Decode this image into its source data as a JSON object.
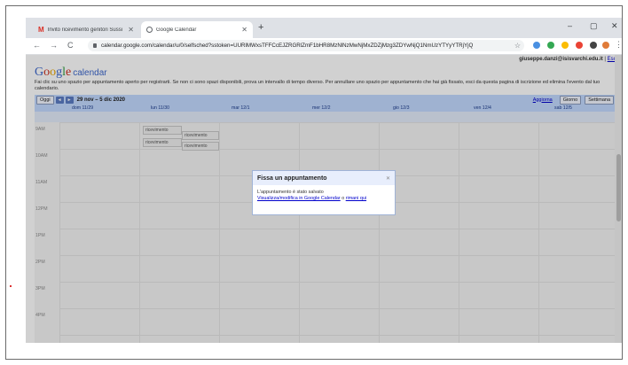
{
  "browser": {
    "tabs": [
      {
        "title": "Invito ricevimento genitori Sussi",
        "icon": "gmail-icon"
      },
      {
        "title": "Google Calendar",
        "icon": "calendar-icon"
      }
    ],
    "new_tab": "+",
    "window_controls": {
      "minimize": "–",
      "maximize": "▢",
      "close": "✕"
    },
    "nav": {
      "back": "←",
      "forward": "→",
      "reload": "C"
    },
    "url": "calendar.google.com/calendar/u/0/selfsched?sstoken=UURlMWxsTFFCcEJZRGRlZmF1bHR8MzNlNzMwNjMxZDZjMzg3ZDYwNjQ1NmUzYTYyYTRjYjQ",
    "star": "☆",
    "menu": "⋮"
  },
  "calendar": {
    "user_email": "giuseppe.danzi@isisvarchi.edu.it",
    "separator": " | ",
    "logout": "Esci",
    "logo_letters": [
      "G",
      "o",
      "o",
      "g",
      "l",
      "e"
    ],
    "logo_suffix": "calendar",
    "info_text": "Fai clic su uno spazio per appuntamento aperto per registrarti. Se non ci sono spazi disponibili, prova un intervallo di tempo diverso. Per annullare uno spazio per appuntamento che hai già fissato, esci da questa pagina di iscrizione ed elimina l'evento dal tuo calendario.",
    "toolbar": {
      "today": "Oggi",
      "prev": "◄",
      "next": "►",
      "range": "29 nov – 5 dic 2020",
      "refresh": "Aggiorna",
      "day": "Giorno",
      "week": "Settimana"
    },
    "days": [
      "dom 11/29",
      "lun 11/30",
      "mar 12/1",
      "mer 12/2",
      "gio 12/3",
      "ven 12/4",
      "sab 12/5"
    ],
    "hours": [
      "9AM",
      "10AM",
      "11AM",
      "12PM",
      "1PM",
      "2PM",
      "3PM",
      "4PM"
    ],
    "events": [
      {
        "label": "ricevimento"
      },
      {
        "label": "ricevimento"
      },
      {
        "label": "ricevimento"
      },
      {
        "label": "ricevimento"
      }
    ]
  },
  "dialog": {
    "title": "Fissa un appuntamento",
    "close": "✕",
    "message": "L'appuntamento è stato salvato",
    "link_view": "Visualizza/modifica in Google Calendar",
    "or": " o ",
    "link_stay": "rimani qui"
  },
  "colors": {
    "toolbar_bg": "#c3d9ff",
    "link": "#0000cc",
    "tabstrip": "#dee1e6"
  }
}
